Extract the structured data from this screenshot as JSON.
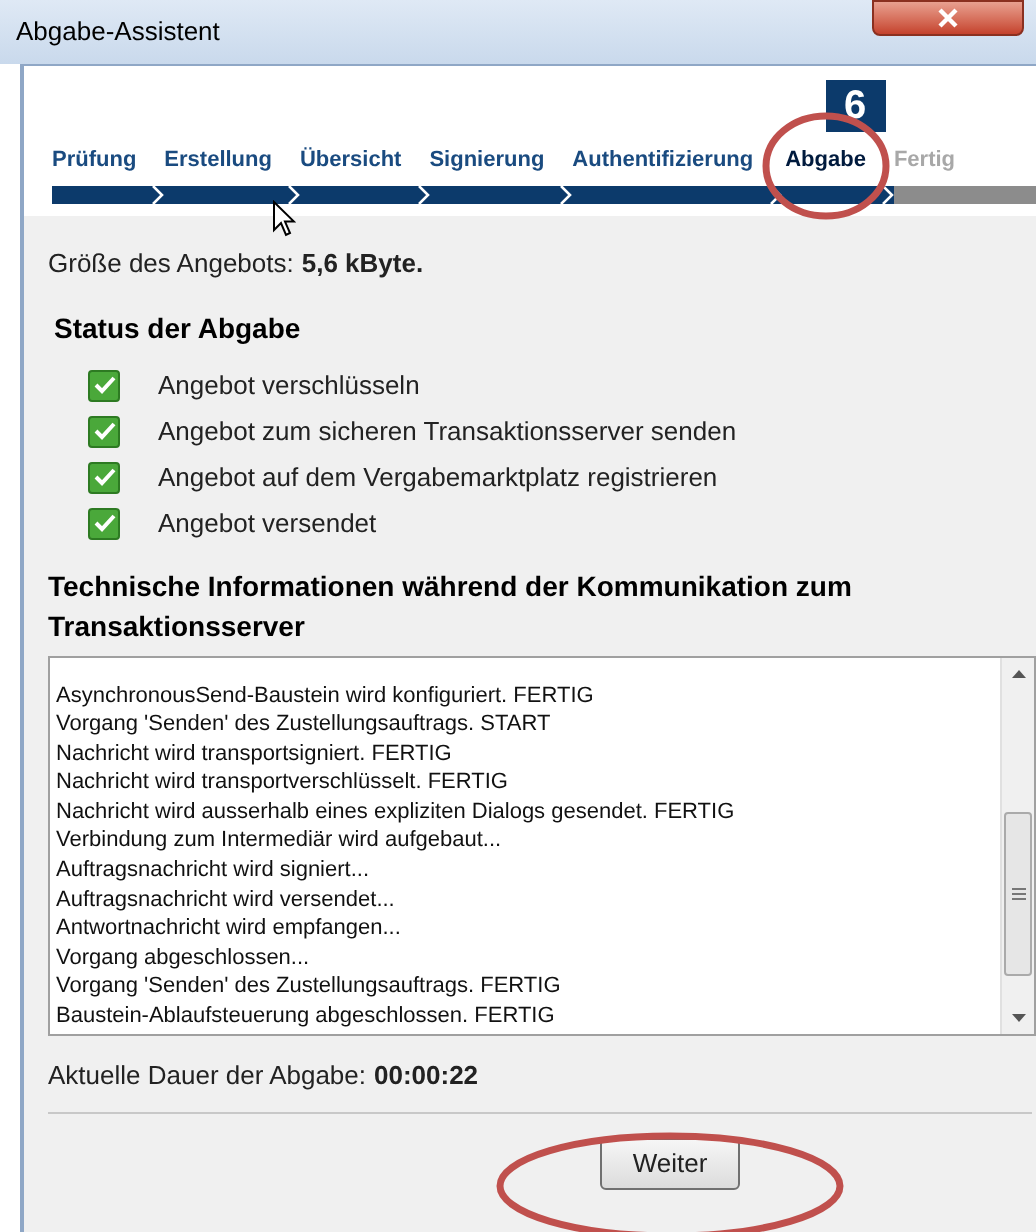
{
  "window": {
    "title": "Abgabe-Assistent"
  },
  "steps": [
    {
      "label": "Prüfung",
      "completed": true,
      "selected": false
    },
    {
      "label": "Erstellung",
      "completed": true,
      "selected": false
    },
    {
      "label": "Übersicht",
      "completed": true,
      "selected": false
    },
    {
      "label": "Signierung",
      "completed": true,
      "selected": false
    },
    {
      "label": "Authentifizierung",
      "completed": true,
      "selected": false
    },
    {
      "label": "Abgabe",
      "completed": true,
      "selected": true,
      "number": "6"
    },
    {
      "label": "Fertig",
      "completed": false,
      "selected": false
    }
  ],
  "size": {
    "label": "Größe des Angebots:",
    "value": "5,6 kByte."
  },
  "status": {
    "title": "Status der Abgabe",
    "items": [
      {
        "label": "Angebot verschlüsseln",
        "checked": true
      },
      {
        "label": "Angebot zum sicheren Transaktionsserver senden",
        "checked": true
      },
      {
        "label": "Angebot auf dem Vergabemarktplatz registrieren",
        "checked": true
      },
      {
        "label": "Angebot versendet",
        "checked": true
      }
    ]
  },
  "log": {
    "title": "Technische Informationen während der Kommunikation zum Transaktionsserver",
    "lines": [
      "AsynchronousSend-Baustein wird konfiguriert. FERTIG",
      "Vorgang 'Senden' des Zustellungsauftrags. START",
      "Nachricht wird transportsigniert. FERTIG",
      "Nachricht wird transportverschlüsselt. FERTIG",
      "Nachricht wird ausserhalb eines expliziten Dialogs gesendet. FERTIG",
      "Verbindung zum Intermediär wird aufgebaut...",
      "Auftragsnachricht wird signiert...",
      "Auftragsnachricht wird versendet...",
      "Antwortnachricht wird empfangen...",
      "Vorgang abgeschlossen...",
      "Vorgang 'Senden' des Zustellungsauftrags. FERTIG",
      "Baustein-Ablaufsteuerung abgeschlossen. FERTIG"
    ]
  },
  "duration": {
    "label": "Aktuelle Dauer der Abgabe:",
    "value": "00:00:22"
  },
  "buttons": [
    "Weiter"
  ]
}
